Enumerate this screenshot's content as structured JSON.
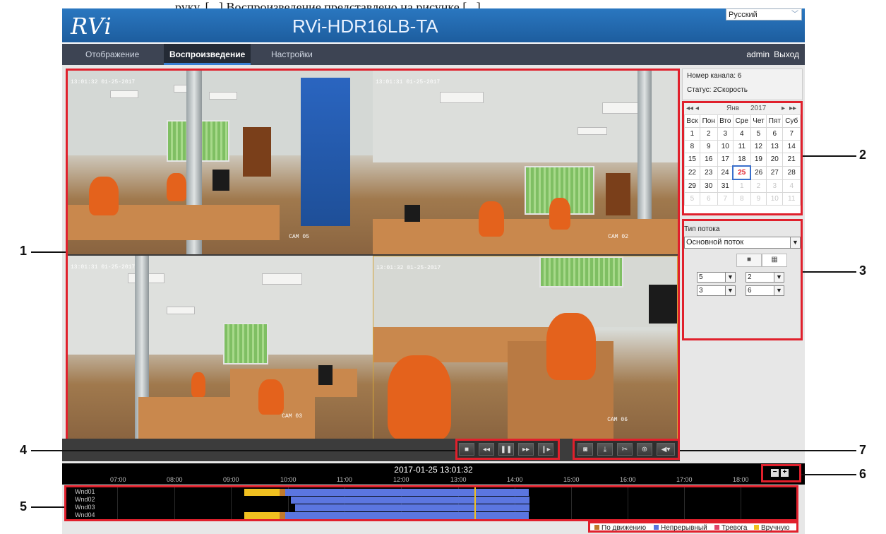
{
  "caption": "руку. [...] Воспроизведение представлено на рисунке [...]",
  "header": {
    "logo": "RVi",
    "device_title": "RVi-HDR16LB-TA",
    "language": "Русский"
  },
  "nav": {
    "items": [
      "Отображение",
      "Воспроизведение",
      "Настройки"
    ],
    "active": "Воспроизведение",
    "user": "admin",
    "logout": "Выход"
  },
  "cameras": [
    {
      "timestamp": "13:01:32 01-25-2017",
      "name": "CAM 05"
    },
    {
      "timestamp": "13:01:31 01-25-2017",
      "name": "CAM 02"
    },
    {
      "timestamp": "13:01:31 01-25-2017",
      "name": "CAM 03"
    },
    {
      "timestamp": "13:01:32 01-25-2017",
      "name": "CAM 06"
    }
  ],
  "info": {
    "channel": "Номер канала: 6",
    "status": "Статус: 2Скорость"
  },
  "calendar": {
    "month": "Янв",
    "year": "2017",
    "weekdays": [
      "Вск",
      "Пон",
      "Вто",
      "Сре",
      "Чет",
      "Пят",
      "Суб"
    ],
    "weeks": [
      [
        "1",
        "2",
        "3",
        "4",
        "5",
        "6",
        "7"
      ],
      [
        "8",
        "9",
        "10",
        "11",
        "12",
        "13",
        "14"
      ],
      [
        "15",
        "16",
        "17",
        "18",
        "19",
        "20",
        "21"
      ],
      [
        "22",
        "23",
        "24",
        "25",
        "26",
        "27",
        "28"
      ],
      [
        "29",
        "30",
        "31",
        "1",
        "2",
        "3",
        "4"
      ],
      [
        "5",
        "6",
        "7",
        "8",
        "9",
        "10",
        "11"
      ]
    ],
    "selected_day": "25"
  },
  "stream": {
    "label": "Тип потока",
    "type": "Основной поток",
    "channels": [
      "5",
      "2",
      "3",
      "6"
    ]
  },
  "timeline": {
    "datetime": "2017-01-25 13:01:32",
    "hours": [
      "07:00",
      "08:00",
      "09:00",
      "10:00",
      "11:00",
      "12:00",
      "13:00",
      "14:00",
      "15:00",
      "16:00",
      "17:00",
      "18:00"
    ],
    "tracks": [
      "Wnd01",
      "Wnd02",
      "Wnd03",
      "Wnd04"
    ]
  },
  "legend": [
    {
      "label": "По движению",
      "color": "#c07a2c"
    },
    {
      "label": "Непрерывный",
      "color": "#5b76e0"
    },
    {
      "label": "Тревога",
      "color": "#e0456a"
    },
    {
      "label": "Вручную",
      "color": "#f0c020"
    }
  ],
  "callouts": [
    "1",
    "2",
    "3",
    "4",
    "5",
    "6",
    "7"
  ]
}
